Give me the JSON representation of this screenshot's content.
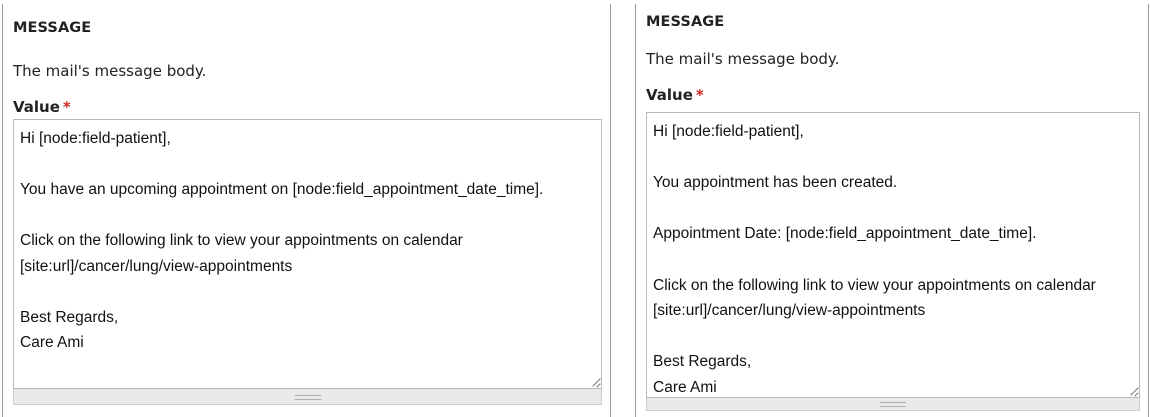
{
  "panels": [
    {
      "heading": "MESSAGE",
      "description": "The mail's message body.",
      "value_label": "Value",
      "required_mark": "*",
      "body": "Hi [node:field-patient],\n\nYou have an upcoming appointment on [node:field_appointment_date_time].\n\nClick on the following link to view your appointments on calendar\n[site:url]/cancer/lung/view-appointments\n\nBest Regards,\nCare Ami"
    },
    {
      "heading": "MESSAGE",
      "description": "The mail's message body.",
      "value_label": "Value",
      "required_mark": "*",
      "body": "Hi [node:field-patient],\n\nYou appointment has been created.\n\nAppointment Date: [node:field_appointment_date_time].\n\nClick on the following link to view your appointments on calendar\n[site:url]/cancer/lung/view-appointments\n\nBest Regards,\nCare Ami"
    }
  ],
  "colors": {
    "required": "#d0261d",
    "border": "#b8b8b8"
  }
}
